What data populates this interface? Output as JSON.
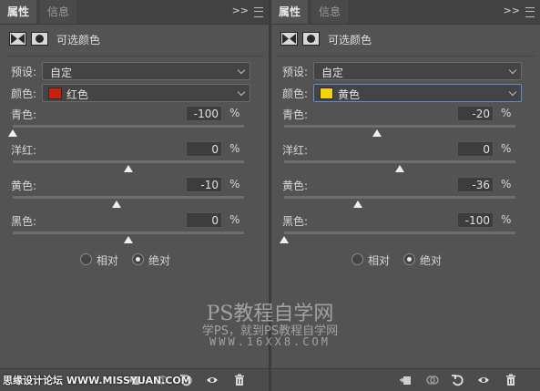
{
  "tabs": {
    "properties": "属性",
    "info": "信息"
  },
  "collapse_symbol": ">>",
  "panel_title": "可选颜色",
  "labels": {
    "preset": "预设:",
    "colors": "颜色:",
    "cyan": "青色:",
    "magenta": "洋红:",
    "yellow": "黄色:",
    "black": "黑色:",
    "percent": "%",
    "relative": "相对",
    "absolute": "绝对"
  },
  "left": {
    "preset_value": "自定",
    "color_value": "红色",
    "swatch_color": "#c8200f",
    "cyan": "-100",
    "magenta": "0",
    "yellow": "-10",
    "black": "0",
    "method": "absolute"
  },
  "right": {
    "preset_value": "自定",
    "color_value": "黄色",
    "swatch_color": "#f2d40a",
    "cyan": "-20",
    "magenta": "0",
    "yellow": "-36",
    "black": "-100",
    "method": "absolute"
  },
  "watermark": {
    "line1": "PS教程自学网",
    "line2": "学PS，就到PS教程自学网",
    "line3": "WWW.16XX8.COM",
    "corner": "思缘设计论坛 WWW.MISSYUAN.COM"
  },
  "bottom_icons": [
    "clip-to-layer-icon",
    "view-previous-state-icon",
    "reset-icon",
    "visibility-eye-icon",
    "trash-icon"
  ]
}
